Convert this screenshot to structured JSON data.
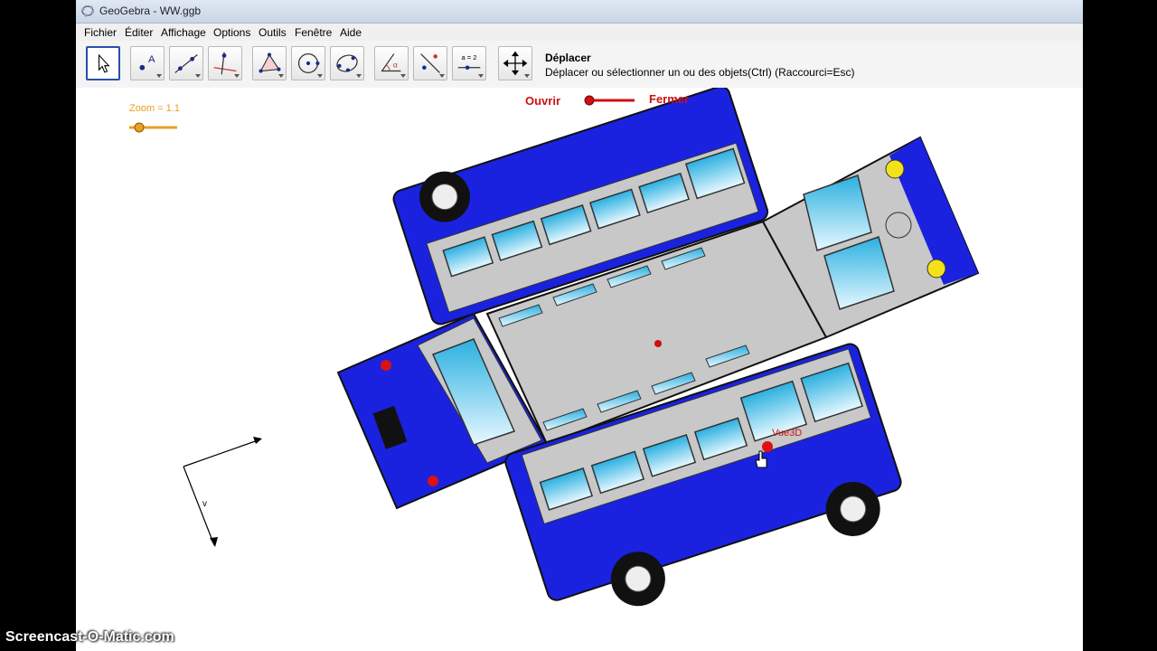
{
  "window": {
    "title": "GeoGebra - WW.ggb"
  },
  "menu": {
    "items": [
      "Fichier",
      "Éditer",
      "Affichage",
      "Options",
      "Outils",
      "Fenêtre",
      "Aide"
    ]
  },
  "toolbar": {
    "tools": [
      {
        "name": "move-tool",
        "icon": "arrow-cursor-icon",
        "selected": true
      },
      {
        "name": "point-tool",
        "icon": "point-icon"
      },
      {
        "name": "line-tool",
        "icon": "line-icon"
      },
      {
        "name": "perpendicular-tool",
        "icon": "perpendicular-icon"
      },
      {
        "name": "polygon-tool",
        "icon": "polygon-icon"
      },
      {
        "name": "circle-tool",
        "icon": "circle-icon"
      },
      {
        "name": "conic-tool",
        "icon": "conic-icon"
      },
      {
        "name": "angle-tool",
        "icon": "angle-icon"
      },
      {
        "name": "reflect-tool",
        "icon": "reflect-icon"
      },
      {
        "name": "slider-tool",
        "icon": "slider-icon",
        "label": "a = 2"
      },
      {
        "name": "move-view-tool",
        "icon": "move-view-icon"
      }
    ],
    "active_tool_name": "Déplacer",
    "active_tool_help": "Déplacer ou sélectionner un ou des objets(Ctrl) (Raccourci=Esc)"
  },
  "canvas": {
    "zoom_slider": {
      "label": "Zoom = 1.1",
      "value": 1.1,
      "color": "#e8a020"
    },
    "open_close_slider": {
      "left_label": "Ouvrir",
      "right_label": "Fermer",
      "color": "#cc1111"
    },
    "point_label": "Vue3D",
    "axis_label": "v",
    "bus_body_color": "#1a22e0",
    "bus_roof_color": "#c8c8c8"
  },
  "watermark": "Screencast-O-Matic.com"
}
